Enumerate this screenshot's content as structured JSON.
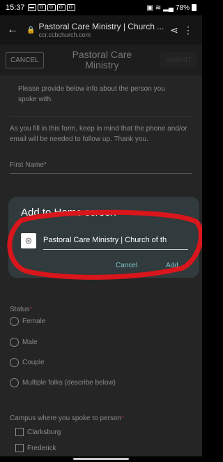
{
  "status_bar": {
    "time": "15:37",
    "battery": "78%"
  },
  "browser": {
    "page_title": "Pastoral Care Ministry | Church ...",
    "url": "ccr.ccbchurch.com"
  },
  "app_header": {
    "cancel_label": "CANCEL",
    "title_line1": "Pastoral Care",
    "title_line2": "Ministry",
    "submit_label": "SUBMIT"
  },
  "form": {
    "intro": "Please provide below info about the person you spoke with.",
    "note": "As you fill in this form, keep in mind that the phone and/or email will be needed to follow up.  Thank you.",
    "first_name_label": "First Name",
    "required_mark": "*",
    "status_label": "Status",
    "status_options": [
      "Female",
      "Male",
      "Couple",
      "Multiple folks (describe below)"
    ],
    "campus_label": "Campus where you spoke to person",
    "campus_options": [
      "Clarksburg",
      "Frederick"
    ]
  },
  "dialog": {
    "title": "Add to Home screen",
    "shortcut_name": "Pastoral Care Ministry | Church of th",
    "cancel_label": "Cancel",
    "add_label": "Add"
  },
  "colors": {
    "annotation": "#d8161c",
    "dialog_bg": "#313a3c",
    "link": "#7fc4d2"
  }
}
